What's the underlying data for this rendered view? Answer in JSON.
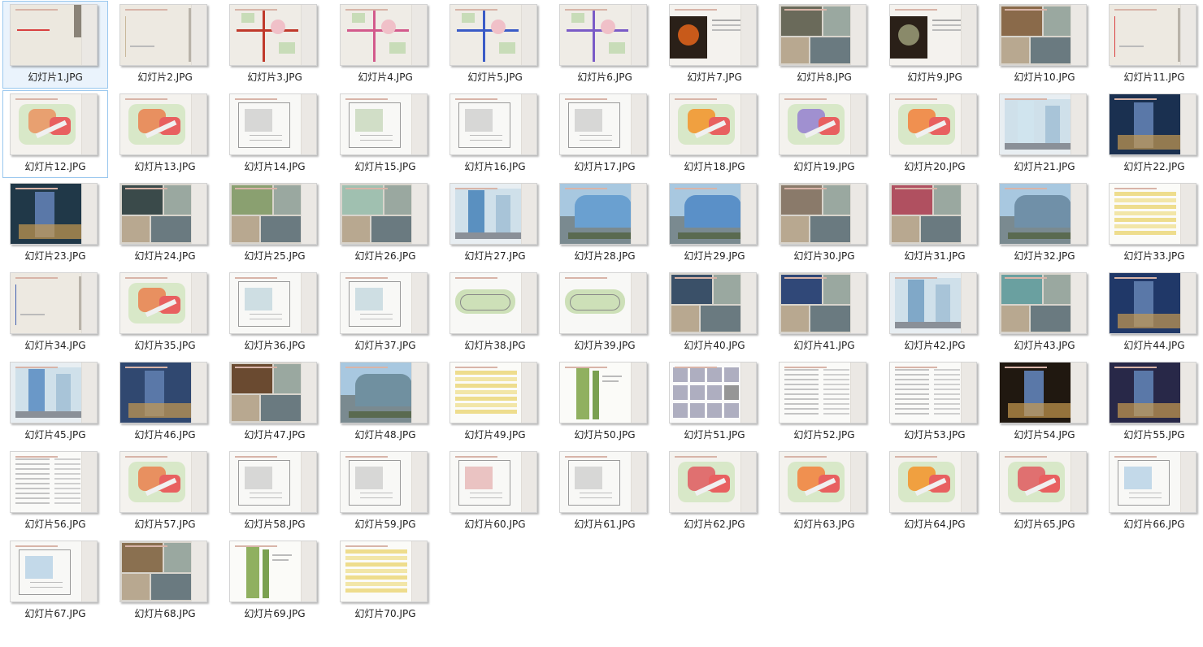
{
  "files": [
    {
      "name": "幻灯片1.JPG",
      "kind": "title-cover",
      "accent": "#d94040"
    },
    {
      "name": "幻灯片2.JPG",
      "kind": "section-divider",
      "accent": "#c8b89a"
    },
    {
      "name": "幻灯片3.JPG",
      "kind": "site-map",
      "accent": "#c0392b"
    },
    {
      "name": "幻灯片4.JPG",
      "kind": "site-map",
      "accent": "#d35a8c"
    },
    {
      "name": "幻灯片5.JPG",
      "kind": "site-map",
      "accent": "#3a5bc7"
    },
    {
      "name": "幻灯片6.JPG",
      "kind": "site-map",
      "accent": "#7a5bc7"
    },
    {
      "name": "幻灯片7.JPG",
      "kind": "photo-text",
      "accent": "#c85a1a"
    },
    {
      "name": "幻灯片8.JPG",
      "kind": "photo-collage",
      "accent": "#6a6a5a"
    },
    {
      "name": "幻灯片9.JPG",
      "kind": "photo-text",
      "accent": "#8a8a6a"
    },
    {
      "name": "幻灯片10.JPG",
      "kind": "photo-collage",
      "accent": "#8a6a4a"
    },
    {
      "name": "幻灯片11.JPG",
      "kind": "section-divider",
      "accent": "#d94040"
    },
    {
      "name": "幻灯片12.JPG",
      "kind": "color-plan",
      "accent": "#e8a070"
    },
    {
      "name": "幻灯片13.JPG",
      "kind": "color-plan",
      "accent": "#e89060"
    },
    {
      "name": "幻灯片14.JPG",
      "kind": "line-plan",
      "accent": "#9a9a9a"
    },
    {
      "name": "幻灯片15.JPG",
      "kind": "line-plan",
      "accent": "#8ab070"
    },
    {
      "name": "幻灯片16.JPG",
      "kind": "line-plan",
      "accent": "#9a9a9a"
    },
    {
      "name": "幻灯片17.JPG",
      "kind": "line-plan",
      "accent": "#9a9a9a"
    },
    {
      "name": "幻灯片18.JPG",
      "kind": "color-plan",
      "accent": "#f0a040"
    },
    {
      "name": "幻灯片19.JPG",
      "kind": "color-plan",
      "accent": "#a090d0"
    },
    {
      "name": "幻灯片20.JPG",
      "kind": "color-plan",
      "accent": "#f09050"
    },
    {
      "name": "幻灯片21.JPG",
      "kind": "tower-render",
      "accent": "#d0e4ee"
    },
    {
      "name": "幻灯片22.JPG",
      "kind": "night-render",
      "accent": "#1a3050"
    },
    {
      "name": "幻灯片23.JPG",
      "kind": "night-render",
      "accent": "#203848"
    },
    {
      "name": "幻灯片24.JPG",
      "kind": "photo-collage",
      "accent": "#3a4a4a"
    },
    {
      "name": "幻灯片25.JPG",
      "kind": "photo-collage",
      "accent": "#8aa070"
    },
    {
      "name": "幻灯片26.JPG",
      "kind": "photo-collage",
      "accent": "#a0c0b0"
    },
    {
      "name": "幻灯片27.JPG",
      "kind": "tower-render",
      "accent": "#5a90c0"
    },
    {
      "name": "幻灯片28.JPG",
      "kind": "day-render",
      "accent": "#6aa0d0"
    },
    {
      "name": "幻灯片29.JPG",
      "kind": "day-render",
      "accent": "#5a90c8"
    },
    {
      "name": "幻灯片30.JPG",
      "kind": "photo-collage",
      "accent": "#8a7a6a"
    },
    {
      "name": "幻灯片31.JPG",
      "kind": "photo-collage",
      "accent": "#b05060"
    },
    {
      "name": "幻灯片32.JPG",
      "kind": "day-render",
      "accent": "#7090a8"
    },
    {
      "name": "幻灯片33.JPG",
      "kind": "table-sheet",
      "accent": "#e8d060"
    },
    {
      "name": "幻灯片34.JPG",
      "kind": "section-divider",
      "accent": "#4060b0"
    },
    {
      "name": "幻灯片35.JPG",
      "kind": "color-plan",
      "accent": "#e89060"
    },
    {
      "name": "幻灯片36.JPG",
      "kind": "line-plan",
      "accent": "#80b0c0"
    },
    {
      "name": "幻灯片37.JPG",
      "kind": "line-plan",
      "accent": "#80b0c0"
    },
    {
      "name": "幻灯片38.JPG",
      "kind": "floor-plan",
      "accent": "#b0d090"
    },
    {
      "name": "幻灯片39.JPG",
      "kind": "floor-plan",
      "accent": "#b0d090"
    },
    {
      "name": "幻灯片40.JPG",
      "kind": "photo-collage",
      "accent": "#3a5068"
    },
    {
      "name": "幻灯片41.JPG",
      "kind": "photo-collage",
      "accent": "#304878"
    },
    {
      "name": "幻灯片42.JPG",
      "kind": "tower-render",
      "accent": "#80a8c8"
    },
    {
      "name": "幻灯片43.JPG",
      "kind": "photo-collage",
      "accent": "#6aa0a0"
    },
    {
      "name": "幻灯片44.JPG",
      "kind": "night-render",
      "accent": "#203868"
    },
    {
      "name": "幻灯片45.JPG",
      "kind": "tower-render",
      "accent": "#6a98c8"
    },
    {
      "name": "幻灯片46.JPG",
      "kind": "night-render",
      "accent": "#304870"
    },
    {
      "name": "幻灯片47.JPG",
      "kind": "photo-collage",
      "accent": "#6a4a30"
    },
    {
      "name": "幻灯片48.JPG",
      "kind": "day-render",
      "accent": "#7090a0"
    },
    {
      "name": "幻灯片49.JPG",
      "kind": "table-sheet",
      "accent": "#e8d060"
    },
    {
      "name": "幻灯片50.JPG",
      "kind": "section-chart",
      "accent": "#90b060"
    },
    {
      "name": "幻灯片51.JPG",
      "kind": "diagram-grid",
      "accent": "#707090"
    },
    {
      "name": "幻灯片52.JPG",
      "kind": "text-page",
      "accent": "#a0a0a0"
    },
    {
      "name": "幻灯片53.JPG",
      "kind": "text-page",
      "accent": "#a0a0a0"
    },
    {
      "name": "幻灯片54.JPG",
      "kind": "night-render",
      "accent": "#201810"
    },
    {
      "name": "幻灯片55.JPG",
      "kind": "night-render",
      "accent": "#282848"
    },
    {
      "name": "幻灯片56.JPG",
      "kind": "text-page",
      "accent": "#a0a0a0"
    },
    {
      "name": "幻灯片57.JPG",
      "kind": "color-plan",
      "accent": "#e89060"
    },
    {
      "name": "幻灯片58.JPG",
      "kind": "line-plan",
      "accent": "#9a9a9a"
    },
    {
      "name": "幻灯片59.JPG",
      "kind": "line-plan",
      "accent": "#9a9a9a"
    },
    {
      "name": "幻灯片60.JPG",
      "kind": "line-plan",
      "accent": "#d06060"
    },
    {
      "name": "幻灯片61.JPG",
      "kind": "line-plan",
      "accent": "#9a9a9a"
    },
    {
      "name": "幻灯片62.JPG",
      "kind": "color-plan",
      "accent": "#e07070"
    },
    {
      "name": "幻灯片63.JPG",
      "kind": "color-plan",
      "accent": "#f09050"
    },
    {
      "name": "幻灯片64.JPG",
      "kind": "color-plan",
      "accent": "#f0a040"
    },
    {
      "name": "幻灯片65.JPG",
      "kind": "color-plan",
      "accent": "#e07070"
    },
    {
      "name": "幻灯片66.JPG",
      "kind": "line-plan",
      "accent": "#60a0d0"
    },
    {
      "name": "幻灯片67.JPG",
      "kind": "line-plan",
      "accent": "#60a0d0"
    },
    {
      "name": "幻灯片68.JPG",
      "kind": "photo-collage",
      "accent": "#8a7050"
    },
    {
      "name": "幻灯片69.JPG",
      "kind": "section-chart",
      "accent": "#90b060"
    },
    {
      "name": "幻灯片70.JPG",
      "kind": "table-sheet",
      "accent": "#e8d060"
    }
  ],
  "selected_index": 0,
  "focused_index": 11
}
